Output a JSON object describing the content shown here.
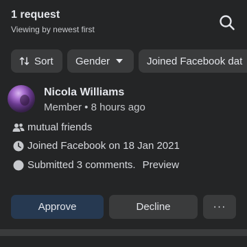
{
  "header": {
    "title": "1 request",
    "subtitle": "Viewing by newest first",
    "search_icon": "search-icon"
  },
  "filters": {
    "sort_label": "Sort",
    "sort_icon": "sort-arrows-icon",
    "gender_label": "Gender",
    "joined_label": "Joined Facebook dat"
  },
  "request": {
    "name": "Nicola Williams",
    "meta": "Member • 8 hours ago",
    "mutual_friends": "mutual friends",
    "joined": "Joined Facebook on 18 Jan 2021",
    "submitted": "Submitted 3 comments.",
    "preview": "Preview",
    "approve": "Approve",
    "decline": "Decline",
    "more": "···"
  },
  "colors": {
    "background": "#242526",
    "chip": "#3a3b3c",
    "approve_bg": "#263951",
    "text": "#e4e6eb"
  }
}
